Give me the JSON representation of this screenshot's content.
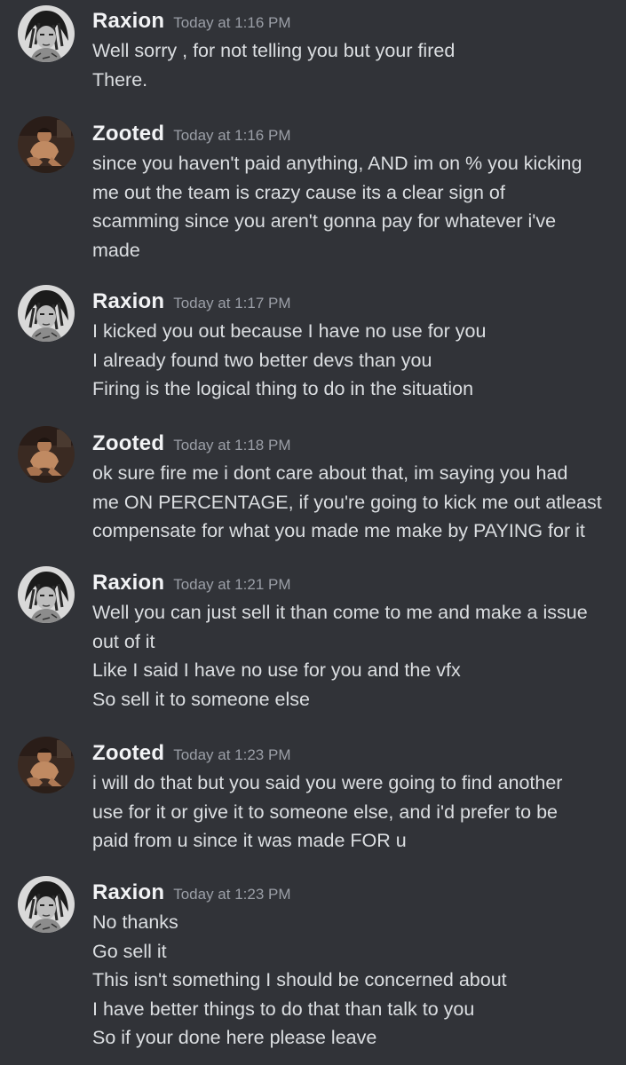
{
  "colors": {
    "background": "#313338",
    "author": "#f2f3f5",
    "timestamp": "#9b9fa7",
    "text": "#dbdee1"
  },
  "messages": [
    {
      "author": "Raxion",
      "time": "Today at 1:16 PM",
      "avatar": "raxion-avatar",
      "lines": [
        "Well sorry , for not telling you but your fired",
        "There."
      ]
    },
    {
      "author": "Zooted",
      "time": "Today at 1:16 PM",
      "avatar": "zooted-avatar",
      "lines": [
        "since you haven't paid anything, AND im on % you kicking",
        "me out the team is crazy cause its a clear sign of",
        "scamming since you aren't gonna pay for whatever i've",
        "made"
      ]
    },
    {
      "author": "Raxion",
      "time": "Today at 1:17 PM",
      "avatar": "raxion-avatar",
      "lines": [
        "I kicked you out because I have no use for you",
        "I already found two better devs than you",
        "Firing is the logical thing to do in the situation"
      ]
    },
    {
      "author": "Zooted",
      "time": "Today at 1:18 PM",
      "avatar": "zooted-avatar",
      "lines": [
        "ok sure fire me i dont care about that, im saying you had",
        "me ON PERCENTAGE, if you're going to kick me out atleast",
        "compensate for what you made me make by PAYING for it"
      ]
    },
    {
      "author": "Raxion",
      "time": "Today at 1:21 PM",
      "avatar": "raxion-avatar",
      "lines": [
        "Well you can just sell it than come to me and make a issue",
        "out of it",
        "Like I said I have no use for you and the vfx",
        "So sell it to someone else"
      ]
    },
    {
      "author": "Zooted",
      "time": "Today at 1:23 PM",
      "avatar": "zooted-avatar",
      "lines": [
        "i will do that but you said you were going to find another",
        "use for it or give it to someone else, and i'd prefer to be",
        "paid from u since it was made FOR u"
      ]
    },
    {
      "author": "Raxion",
      "time": "Today at 1:23 PM",
      "avatar": "raxion-avatar",
      "lines": [
        "No thanks",
        "Go sell it",
        "This isn't something I should be concerned about",
        "I have better things to do that than talk to you",
        "So if your done here please leave"
      ]
    }
  ]
}
